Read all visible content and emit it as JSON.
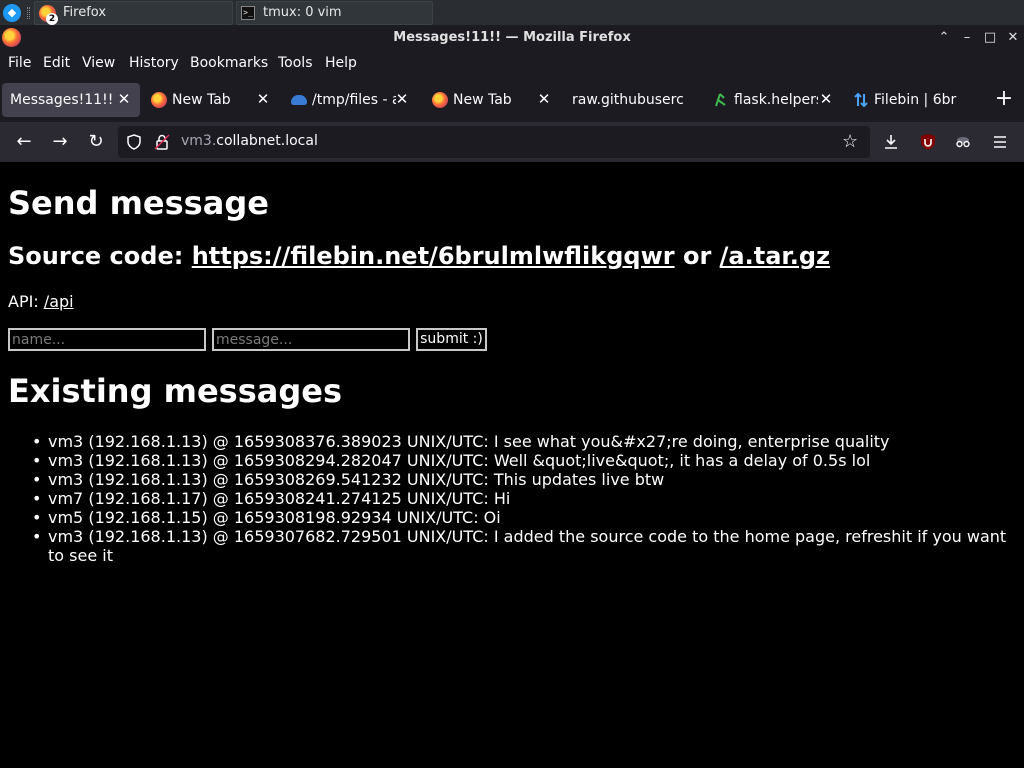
{
  "taskbar": {
    "tasks": [
      {
        "label": "Firefox",
        "badge": "2"
      },
      {
        "label": "tmux: 0 vim"
      }
    ]
  },
  "window": {
    "title": "Messages!11!! — Mozilla Firefox",
    "controls": [
      "⌃",
      "–",
      "□",
      "✕"
    ]
  },
  "menus": [
    "File",
    "Edit",
    "View",
    "History",
    "Bookmarks",
    "Tools",
    "Help"
  ],
  "tabs": [
    {
      "label": "Messages!11!!",
      "active": true,
      "icon": "none"
    },
    {
      "label": "New Tab",
      "icon": "firefox-icon"
    },
    {
      "label": "/tmp/files - a",
      "icon": "cloud-icon"
    },
    {
      "label": "New Tab",
      "icon": "firefox-icon"
    },
    {
      "label": "raw.githubuserc",
      "icon": "none"
    },
    {
      "label": "flask.helpers",
      "icon": "flask-icon"
    },
    {
      "label": "Filebin | 6br",
      "icon": "filebin-icon"
    }
  ],
  "tab_close_glyph": "✕",
  "new_tab_glyph": "+",
  "nav": {
    "url_dim_prefix": "vm3.",
    "url_main": "collabnet.local",
    "back": "←",
    "forward": "→",
    "reload": "↻",
    "star": "☆"
  },
  "page": {
    "heading": "Send message",
    "source_prefix": "Source code: ",
    "source_link": "https://filebin.net/6brulmlwflikgqwr",
    "source_or": " or ",
    "source_link2": "/a.tar.gz",
    "api_prefix": "API: ",
    "api_link": "/api",
    "name_placeholder": "name...",
    "message_placeholder": "message...",
    "submit_label": "submit :)",
    "messages_heading": "Existing messages",
    "messages": [
      "vm3 (192.168.1.13) @ 1659308376.389023 UNIX/UTC: I see what you&#x27;re doing, enterprise quality",
      "vm3 (192.168.1.13) @ 1659308294.282047 UNIX/UTC: Well &quot;live&quot;, it has a delay of 0.5s lol",
      "vm3 (192.168.1.13) @ 1659308269.541232 UNIX/UTC: This updates live btw",
      "vm7 (192.168.1.17) @ 1659308241.274125 UNIX/UTC: Hi",
      "vm5 (192.168.1.15) @ 1659308198.92934 UNIX/UTC: Oi",
      "vm3 (192.168.1.13) @ 1659307682.729501 UNIX/UTC: I added the source code to the home page, refreshit if you want to see it"
    ]
  }
}
